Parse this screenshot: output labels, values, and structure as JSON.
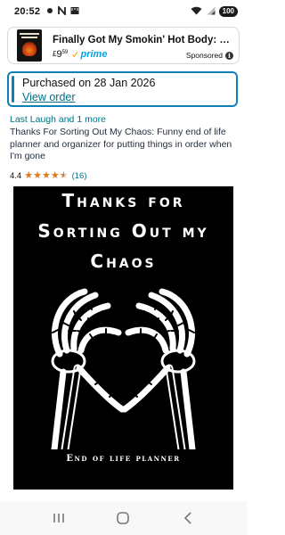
{
  "status_bar": {
    "time": "20:52",
    "battery": "100",
    "left_icons": [
      "notification-dot-icon",
      "nfc-n-icon",
      "gallery-icon"
    ],
    "right_icons": [
      "wifi-icon",
      "signal-icon",
      "battery-icon"
    ]
  },
  "ad": {
    "title": "Finally Got My Smokin' Hot Body: Fun...",
    "price_currency": "£",
    "price_whole": "9",
    "price_fraction": "59",
    "prime_check": "✓",
    "prime_label": "prime",
    "sponsored_label": "Sponsored",
    "info_icon": "i"
  },
  "purchase": {
    "purchased_text": "Purchased on 28 Jan 2026",
    "view_order_label": "View order"
  },
  "product": {
    "brand": "Last Laugh and 1 more",
    "title": "Thanks For Sorting Out My Chaos: Funny end of life planner and organizer for putting things in order when I'm gone",
    "rating": "4.4",
    "stars": 4.4,
    "review_count": "(16)"
  },
  "cover": {
    "line1": "Thanks for",
    "line2": "Sorting Out my",
    "line3": "Chaos",
    "subtitle": "End of life planner"
  },
  "nav": {
    "recents_icon": "recents-icon",
    "home_icon": "home-icon",
    "back_icon": "back-icon"
  },
  "colors": {
    "link": "#007185",
    "star": "#de7921",
    "prime_blue": "#00a8e1",
    "prime_check": "#ff9900",
    "accent_border": "#0e80b8"
  }
}
